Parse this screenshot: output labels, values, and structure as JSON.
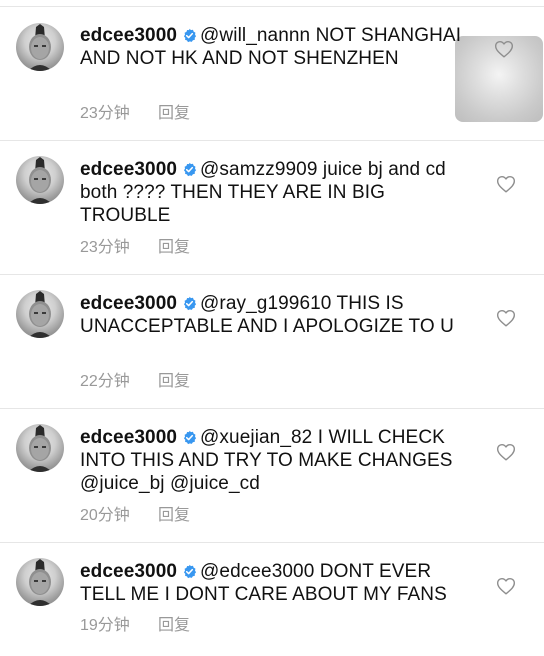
{
  "comments": [
    {
      "username": "edcee3000",
      "text": "@will_nannn NOT SHANGHAI AND NOT HK AND NOT SHENZHEN",
      "time": "23分钟",
      "reply": "回复"
    },
    {
      "username": "edcee3000",
      "text": "@samzz9909 juice bj and cd both ???? THEN THEY ARE IN BIG TROUBLE",
      "time": "23分钟",
      "reply": "回复"
    },
    {
      "username": "edcee3000",
      "text": "@ray_g199610 THIS IS UNACCEPTABLE AND I APOLOGIZE TO U",
      "time": "22分钟",
      "reply": "回复"
    },
    {
      "username": "edcee3000",
      "text": "@xuejian_82 I WILL CHECK INTO THIS AND TRY TO MAKE CHANGES @juice_bj @juice_cd",
      "time": "20分钟",
      "reply": "回复"
    },
    {
      "username": "edcee3000",
      "text": "@edcee3000 DONT EVER TELL ME I DONT CARE ABOUT MY FANS",
      "time": "19分钟",
      "reply": "回复"
    }
  ],
  "colors": {
    "text": "#111111",
    "meta": "#999999",
    "verified": "#3897f0",
    "divider": "#e6e6e6"
  },
  "icons": {
    "verified": "verified-badge-icon",
    "like": "heart-outline-icon"
  }
}
